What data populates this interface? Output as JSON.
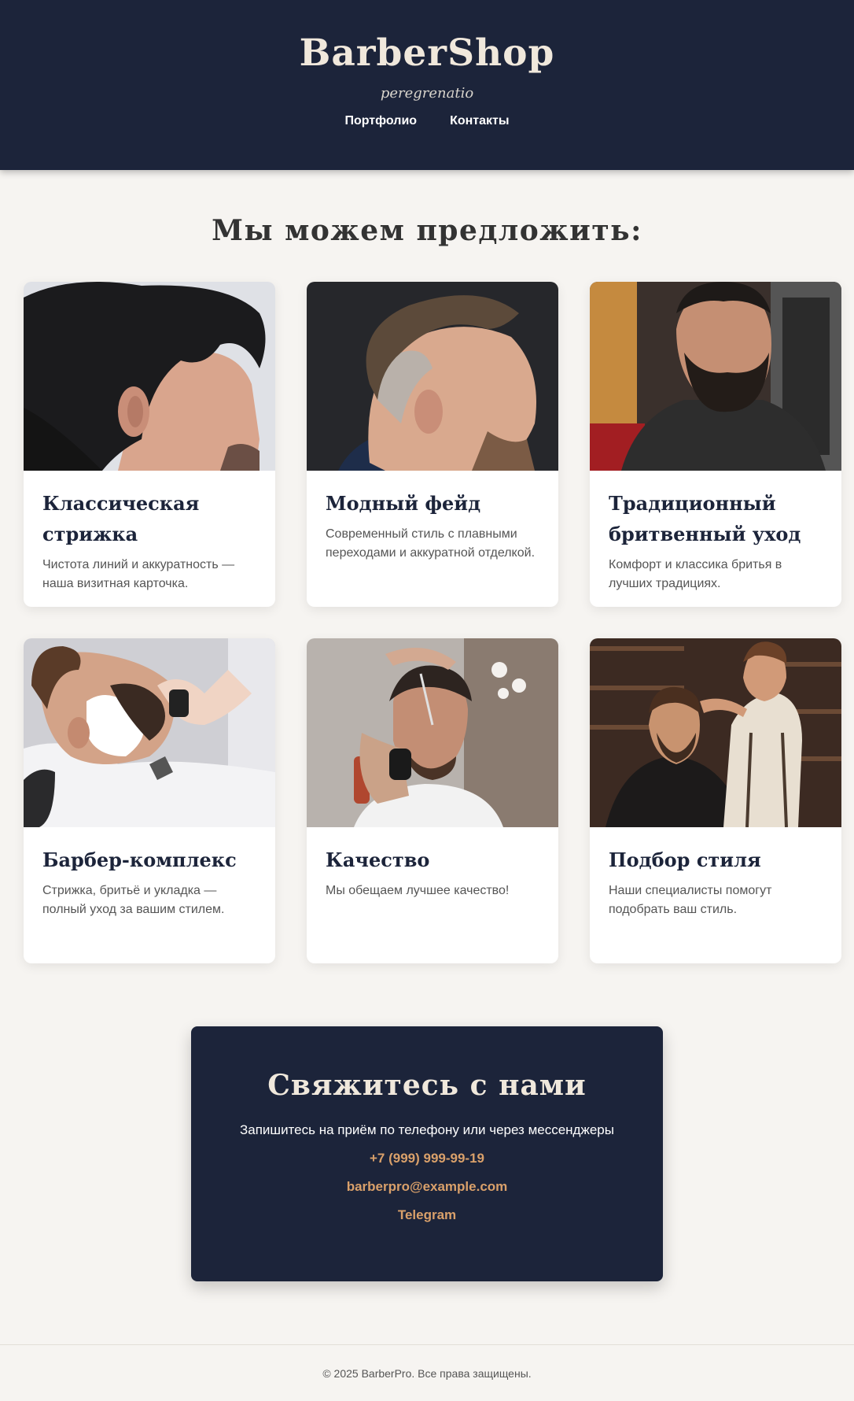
{
  "header": {
    "logo": "BarberShop",
    "tagline": "peregrenatio",
    "nav": [
      {
        "label": "Портфолио"
      },
      {
        "label": "Контакты"
      }
    ]
  },
  "services": {
    "title": "Мы можем предложить:",
    "cards": [
      {
        "title": "Классическая стрижка",
        "text": "Чистота линий и аккуратность — наша визитная карточка.",
        "photo": "classic-haircut-photo"
      },
      {
        "title": "Модный фейд",
        "text": "Современный стиль с плавными переходами и аккуратной отделкой.",
        "photo": "fade-haircut-photo"
      },
      {
        "title": "Традиционный бритвенный уход",
        "text": "Комфорт и классика бритья в лучших традициях.",
        "photo": "beard-grooming-photo"
      },
      {
        "title": "Барбер-комплекс",
        "text": "Стрижка, бритьё и укладка — полный уход за вашим стилем.",
        "photo": "shaving-foam-photo"
      },
      {
        "title": "Качество",
        "text": "Мы обещаем лучшее качество!",
        "photo": "scissors-haircut-photo"
      },
      {
        "title": "Подбор стиля",
        "text": "Наши специалисты помогут подобрать ваш стиль.",
        "photo": "barbershop-interior-photo"
      }
    ]
  },
  "contact": {
    "title": "Свяжитесь с нами",
    "text": "Запишитесь на приём по телефону или через мессенджеры",
    "phone": "+7 (999) 999-99-19",
    "email": "barberpro@example.com",
    "telegram": "Telegram"
  },
  "footer": {
    "text": "© 2025 BarberPro. Все права защищены."
  },
  "colors": {
    "navy": "#1c243a",
    "accent": "#d9a06a",
    "background": "#f6f4f1",
    "cream": "#f0e8dc"
  }
}
